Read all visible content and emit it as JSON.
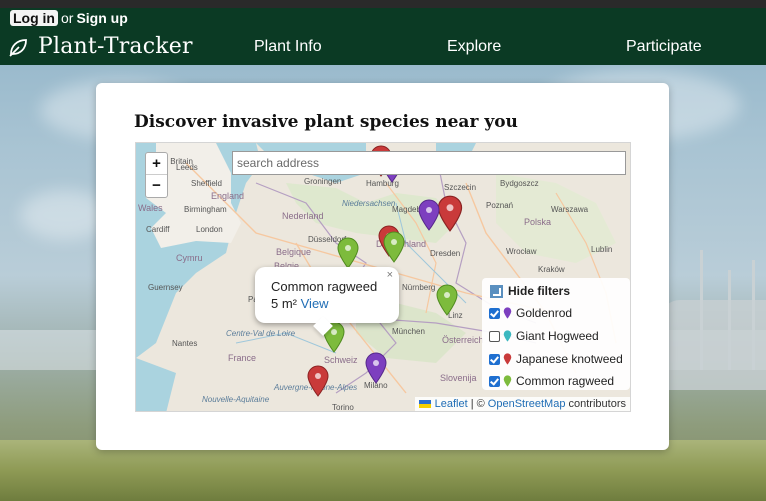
{
  "auth": {
    "login": "Log in",
    "or": "or",
    "signup": "Sign up"
  },
  "brand": {
    "name": "Plant-Tracker",
    "icon": "leaf-icon"
  },
  "nav": {
    "items": [
      "Plant Info",
      "Explore",
      "Participate"
    ]
  },
  "main": {
    "title": "Discover invasive plant species near you"
  },
  "search": {
    "placeholder": "search address"
  },
  "zoom": {
    "in": "+",
    "out": "−"
  },
  "popup": {
    "close": "×",
    "name": "Common ragweed",
    "area": "5 m²",
    "link": "View"
  },
  "filters": {
    "header": "Hide filters",
    "items": [
      {
        "label": "Goldenrod",
        "checked": true,
        "color": "#7d3fbf"
      },
      {
        "label": "Giant Hogweed",
        "checked": false,
        "color": "#3cb8c0"
      },
      {
        "label": "Japanese knotweed",
        "checked": true,
        "color": "#c93a3a"
      },
      {
        "label": "Common ragweed",
        "checked": true,
        "color": "#7dbb3c"
      }
    ]
  },
  "attribution": {
    "leaflet": "Leaflet",
    "sep": "| ©",
    "osm": "OpenStreetMap",
    "suffix": "contributors"
  },
  "map_labels": {
    "cities": [
      "Great Britain",
      "Leeds",
      "Sheffield",
      "Birmingham",
      "Cardiff",
      "London",
      "Groningen",
      "Hamburg",
      "Szczecin",
      "Bydgoszcz",
      "Nederland",
      "Niedersachsen",
      "Magdeburg",
      "Poznań",
      "Polska",
      "Warszawa",
      "Düsseldorf",
      "Deutschland",
      "Belgique",
      "Belgie",
      "Dresden",
      "Wrocław",
      "Lublin",
      "Kraków",
      "Guernsey",
      "Paris",
      "Nantes",
      "France",
      "Centre-Val de Loire",
      "Nouvelle-Aquitaine",
      "Auvergne-Rhône-Alpes",
      "Schweiz",
      "Milano",
      "Torino",
      "München",
      "Linz",
      "Österreich",
      "Slovenija",
      "Nürnberg",
      "Wales",
      "England",
      "Cymru"
    ]
  },
  "colors": {
    "nav_bg": "#0b3a24",
    "goldenrod": "#7d3fbf",
    "giant_hogweed": "#3cb8c0",
    "japanese_knotweed": "#c93a3a",
    "common_ragweed": "#7dbb3c"
  }
}
